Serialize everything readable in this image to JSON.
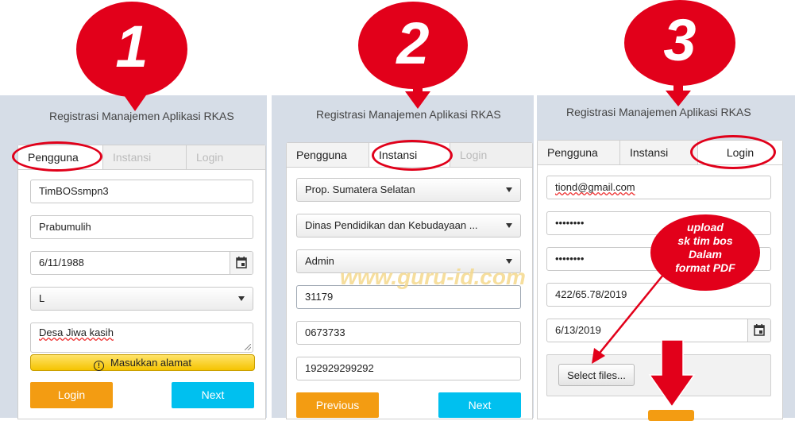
{
  "watermark": "www.guru-id.com",
  "steps": [
    "1",
    "2",
    "3"
  ],
  "panel1": {
    "title": "Registrasi Manajemen Aplikasi RKAS",
    "tabs": [
      "Pengguna",
      "Instansi",
      "Login"
    ],
    "fields": {
      "username": "TimBOSsmpn3",
      "city": "Prabumulih",
      "birthdate": "6/11/1988",
      "gender": "L",
      "address": "Desa Jiwa kasih"
    },
    "warning": "Masukkan alamat",
    "login_label": "Login",
    "next_label": "Next"
  },
  "panel2": {
    "title": "Registrasi Manajemen Aplikasi RKAS",
    "tabs": [
      "Pengguna",
      "Instansi",
      "Login"
    ],
    "fields": {
      "province": "Prop. Sumatera Selatan",
      "agency": "Dinas Pendidikan dan Kebudayaan ...",
      "role": "Admin",
      "code1": "31179",
      "code2": "0673733",
      "code3": "192929299292"
    },
    "previous_label": "Previous",
    "next_label": "Next"
  },
  "panel3": {
    "title": "Registrasi Manajemen Aplikasi RKAS",
    "tabs": [
      "Pengguna",
      "Instansi",
      "Login"
    ],
    "fields": {
      "email": "tiond@gmail.com",
      "password": "••••••••",
      "password_confirm": "••••••••",
      "sk_number": "422/65.78/2019",
      "sk_date": "6/13/2019"
    },
    "select_files_label": "Select files...",
    "upload_note": [
      "upload",
      "sk tim bos",
      "Dalam",
      "format PDF"
    ]
  },
  "colors": {
    "annotation_red": "#e2001a",
    "button_orange": "#f39c12",
    "button_cyan": "#00c0ef",
    "panel_bg": "#d6dde7"
  }
}
